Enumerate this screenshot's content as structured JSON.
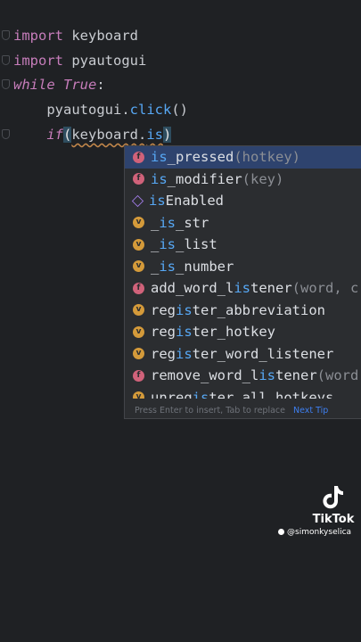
{
  "code": {
    "line1": {
      "kw": "import",
      "rest": " keyboard"
    },
    "line2": {
      "kw": "import",
      "rest": " pyautogui"
    },
    "line3": {
      "kw": "while",
      "val": "True",
      "end": ":"
    },
    "line4": {
      "indent": "    ",
      "obj": "pyautogui.",
      "method": "click",
      "end": "()"
    },
    "line5": {
      "indent": "    ",
      "kw": "if",
      "open": "(",
      "obj": "keyboard.",
      "typed": "is",
      "close": ")"
    }
  },
  "completion": {
    "items": [
      {
        "kind": "f",
        "pre": "",
        "match": "is",
        "post": "_pressed",
        "params": "(hotkey)"
      },
      {
        "kind": "f",
        "pre": "",
        "match": "is",
        "post": "_modifier",
        "params": "(key)"
      },
      {
        "kind": "p",
        "pre": "",
        "match": "is",
        "post": "Enabled",
        "params": ""
      },
      {
        "kind": "v",
        "pre": "_",
        "match": "is",
        "post": "_str",
        "params": ""
      },
      {
        "kind": "v",
        "pre": "_",
        "match": "is",
        "post": "_list",
        "params": ""
      },
      {
        "kind": "v",
        "pre": "_",
        "match": "is",
        "post": "_number",
        "params": ""
      },
      {
        "kind": "f",
        "pre": "add_word_l",
        "match": "is",
        "post": "tener",
        "params": "(word, c"
      },
      {
        "kind": "v",
        "pre": "reg",
        "match": "is",
        "post": "ter_abbreviation",
        "params": ""
      },
      {
        "kind": "v",
        "pre": "reg",
        "match": "is",
        "post": "ter_hotkey",
        "params": ""
      },
      {
        "kind": "v",
        "pre": "reg",
        "match": "is",
        "post": "ter_word_listener",
        "params": ""
      },
      {
        "kind": "f",
        "pre": "remove_word_l",
        "match": "is",
        "post": "tener",
        "params": "(word"
      },
      {
        "kind": "v",
        "pre": "unreg",
        "match": "is",
        "post": "ter_all_hotkeys",
        "params": ""
      }
    ],
    "footer_hint": "Press Enter to insert, Tab to replace",
    "footer_link": "Next Tip"
  },
  "watermark": {
    "brand": "TikTok",
    "user": "@simonkyselica"
  },
  "colors": {
    "background": "#1f2124",
    "keyword": "#c77dbb",
    "function": "#57a8f5",
    "selection": "#2e436e"
  }
}
